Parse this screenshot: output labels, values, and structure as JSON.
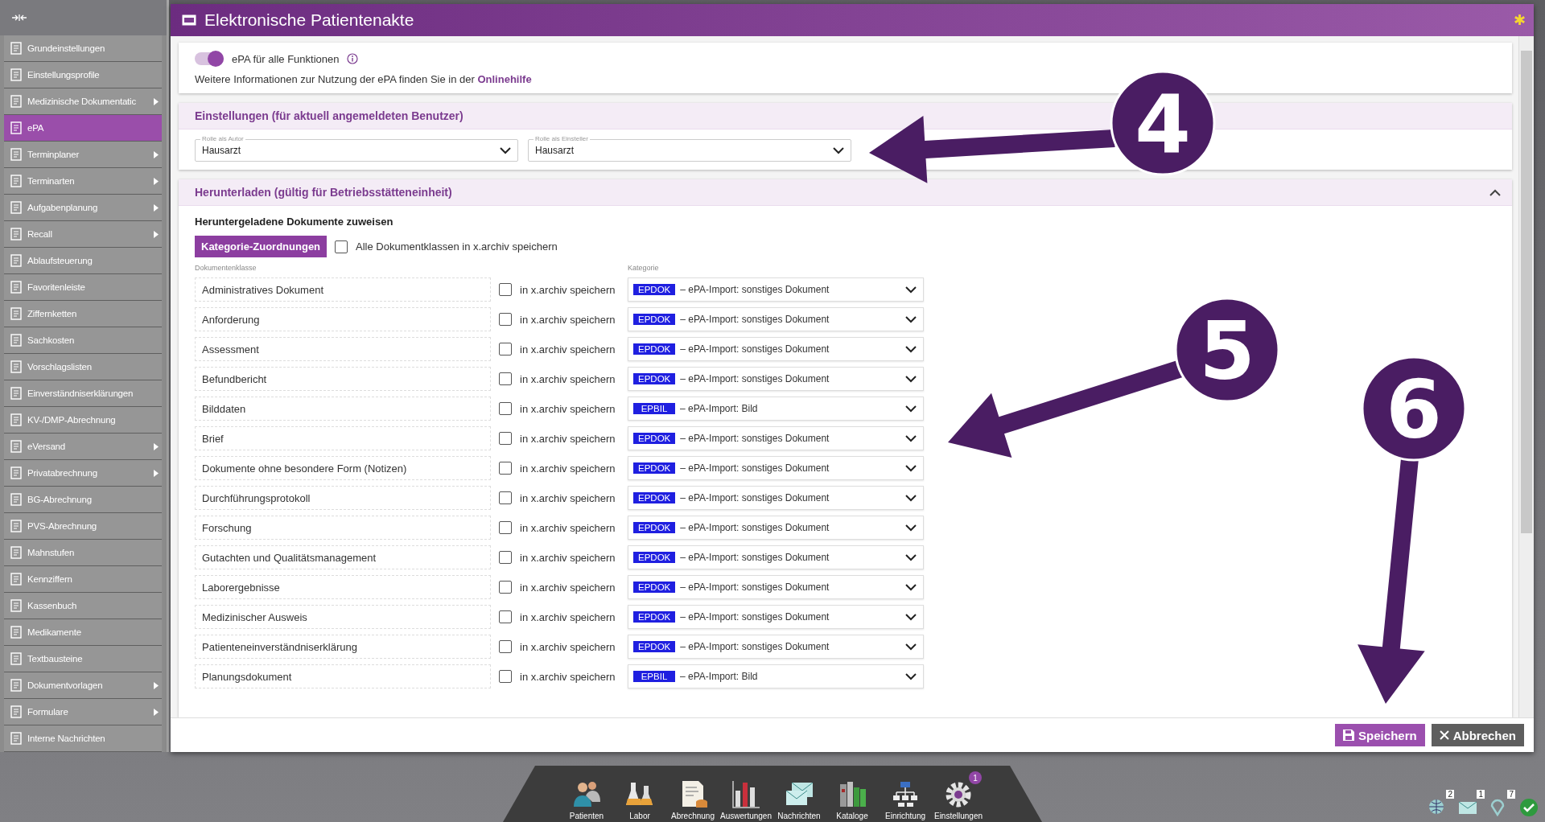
{
  "sidebar": {
    "items": [
      {
        "label": "Grundeinstellungen",
        "has_submenu": false,
        "selected": false
      },
      {
        "label": "Einstellungsprofile",
        "has_submenu": false,
        "selected": false
      },
      {
        "label": "Medizinische Dokumentatic",
        "has_submenu": true,
        "selected": false
      },
      {
        "label": "ePA",
        "has_submenu": false,
        "selected": true
      },
      {
        "label": "Terminplaner",
        "has_submenu": true,
        "selected": false
      },
      {
        "label": "Terminarten",
        "has_submenu": true,
        "selected": false
      },
      {
        "label": "Aufgabenplanung",
        "has_submenu": true,
        "selected": false
      },
      {
        "label": "Recall",
        "has_submenu": true,
        "selected": false
      },
      {
        "label": "Ablaufsteuerung",
        "has_submenu": false,
        "selected": false
      },
      {
        "label": "Favoritenleiste",
        "has_submenu": false,
        "selected": false
      },
      {
        "label": "Ziffernketten",
        "has_submenu": false,
        "selected": false
      },
      {
        "label": "Sachkosten",
        "has_submenu": false,
        "selected": false
      },
      {
        "label": "Vorschlagslisten",
        "has_submenu": false,
        "selected": false
      },
      {
        "label": "Einverständniserklärungen",
        "has_submenu": false,
        "selected": false
      },
      {
        "label": "KV-/DMP-Abrechnung",
        "has_submenu": false,
        "selected": false
      },
      {
        "label": "eVersand",
        "has_submenu": true,
        "selected": false
      },
      {
        "label": "Privatabrechnung",
        "has_submenu": true,
        "selected": false
      },
      {
        "label": "BG-Abrechnung",
        "has_submenu": false,
        "selected": false
      },
      {
        "label": "PVS-Abrechnung",
        "has_submenu": false,
        "selected": false
      },
      {
        "label": "Mahnstufen",
        "has_submenu": false,
        "selected": false
      },
      {
        "label": "Kennziffern",
        "has_submenu": false,
        "selected": false
      },
      {
        "label": "Kassenbuch",
        "has_submenu": false,
        "selected": false
      },
      {
        "label": "Medikamente",
        "has_submenu": false,
        "selected": false
      },
      {
        "label": "Textbausteine",
        "has_submenu": false,
        "selected": false
      },
      {
        "label": "Dokumentvorlagen",
        "has_submenu": true,
        "selected": false
      },
      {
        "label": "Formulare",
        "has_submenu": true,
        "selected": false
      },
      {
        "label": "Interne Nachrichten",
        "has_submenu": false,
        "selected": false
      }
    ]
  },
  "window": {
    "title": "Elektronische Patientenakte",
    "title_marker": "✱"
  },
  "epa_toggle": {
    "label": "ePA für alle Funktionen",
    "on": true
  },
  "info_text": "Weitere Informationen zur Nutzung der ePA finden Sie in der",
  "help_link": "Onlinehilfe",
  "settings_section": {
    "title": "Einstellungen (für aktuell angemeldeten Benutzer)",
    "fields": [
      {
        "label": "Rolle als Autor",
        "value": "Hausarzt"
      },
      {
        "label": "Rolle als Einsteller",
        "value": "Hausarzt"
      }
    ]
  },
  "download_section": {
    "title": "Herunterladen (gültig für Betriebsstätteneinheit)",
    "expanded": true,
    "subtitle": "Heruntergeladene Dokumente zuweisen",
    "assign_button": "Kategorie-Zuordnungen",
    "all_checkbox": {
      "label": "Alle Dokumentklassen in x.archiv speichern",
      "checked": false
    },
    "columns": [
      "Dokumentenklasse",
      "Kategorie"
    ],
    "rows": [
      {
        "class": "Administratives Dokument",
        "archive_label": "in x.archiv speichern",
        "checked": false,
        "code": "EPDOK",
        "category": "– ePA-Import: sonstiges Dokument"
      },
      {
        "class": "Anforderung",
        "archive_label": "in x.archiv speichern",
        "checked": false,
        "code": "EPDOK",
        "category": "– ePA-Import: sonstiges Dokument"
      },
      {
        "class": "Assessment",
        "archive_label": "in x.archiv speichern",
        "checked": false,
        "code": "EPDOK",
        "category": "– ePA-Import: sonstiges Dokument"
      },
      {
        "class": "Befundbericht",
        "archive_label": "in x.archiv speichern",
        "checked": false,
        "code": "EPDOK",
        "category": "– ePA-Import: sonstiges Dokument"
      },
      {
        "class": "Bilddaten",
        "archive_label": "in x.archiv speichern",
        "checked": false,
        "code": "EPBIL",
        "category": "– ePA-Import: Bild"
      },
      {
        "class": "Brief",
        "archive_label": "in x.archiv speichern",
        "checked": false,
        "code": "EPDOK",
        "category": "– ePA-Import: sonstiges Dokument"
      },
      {
        "class": "Dokumente ohne besondere Form (Notizen)",
        "archive_label": "in x.archiv speichern",
        "checked": false,
        "code": "EPDOK",
        "category": "– ePA-Import: sonstiges Dokument"
      },
      {
        "class": "Durchführungsprotokoll",
        "archive_label": "in x.archiv speichern",
        "checked": false,
        "code": "EPDOK",
        "category": "– ePA-Import: sonstiges Dokument"
      },
      {
        "class": "Forschung",
        "archive_label": "in x.archiv speichern",
        "checked": false,
        "code": "EPDOK",
        "category": "– ePA-Import: sonstiges Dokument"
      },
      {
        "class": "Gutachten und Qualitätsmanagement",
        "archive_label": "in x.archiv speichern",
        "checked": false,
        "code": "EPDOK",
        "category": "– ePA-Import: sonstiges Dokument"
      },
      {
        "class": "Laborergebnisse",
        "archive_label": "in x.archiv speichern",
        "checked": false,
        "code": "EPDOK",
        "category": "– ePA-Import: sonstiges Dokument"
      },
      {
        "class": "Medizinischer Ausweis",
        "archive_label": "in x.archiv speichern",
        "checked": false,
        "code": "EPDOK",
        "category": "– ePA-Import: sonstiges Dokument"
      },
      {
        "class": "Patienteneinverständniserklärung",
        "archive_label": "in x.archiv speichern",
        "checked": false,
        "code": "EPDOK",
        "category": "– ePA-Import: sonstiges Dokument"
      },
      {
        "class": "Planungsdokument",
        "archive_label": "in x.archiv speichern",
        "checked": false,
        "code": "EPBIL",
        "category": "– ePA-Import: Bild"
      }
    ]
  },
  "buttons": [
    {
      "kind": "save",
      "label": "Speichern"
    },
    {
      "kind": "cancel",
      "label": "Abbrechen"
    }
  ],
  "taskbar": [
    {
      "kind": "people",
      "label": "Patienten"
    },
    {
      "kind": "flask",
      "label": "Labor"
    },
    {
      "kind": "invoice",
      "label": "Abrechnung"
    },
    {
      "kind": "chart",
      "label": "Auswertungen"
    },
    {
      "kind": "mail",
      "label": "Nachrichten"
    },
    {
      "kind": "books",
      "label": "Kataloge"
    },
    {
      "kind": "network",
      "label": "Einrichtung"
    },
    {
      "kind": "gear",
      "label": "Einstellungen",
      "badge": "1"
    }
  ],
  "tray": [
    {
      "kind": "globe",
      "count": "2"
    },
    {
      "kind": "mail",
      "count": "1"
    },
    {
      "kind": "pin",
      "count": "7"
    },
    {
      "kind": "check"
    }
  ],
  "annotations": [
    {
      "label": "4"
    },
    {
      "label": "5"
    },
    {
      "label": "6"
    }
  ]
}
